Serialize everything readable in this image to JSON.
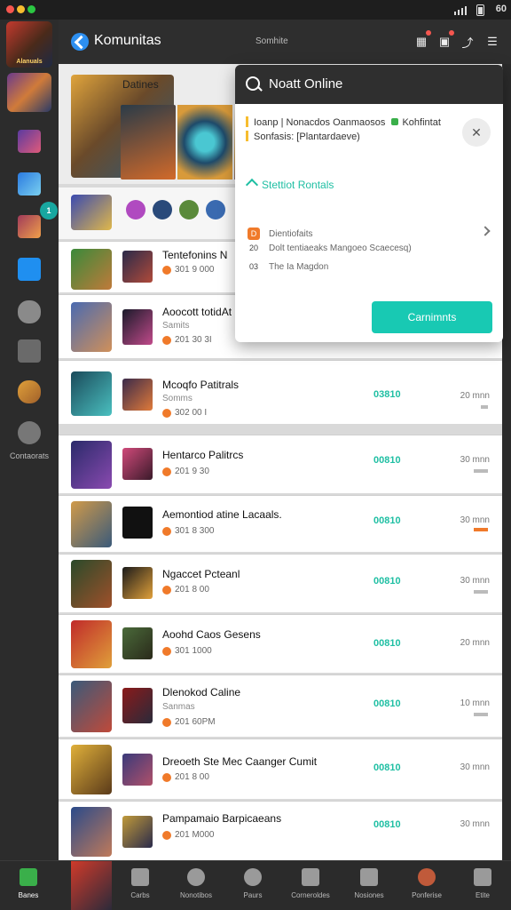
{
  "status_bar": {
    "right_text": "60"
  },
  "header": {
    "app_title": "Komunitas",
    "center_text": "Somhite"
  },
  "rail": {
    "badge": "1",
    "bottom_label": "Contaorats",
    "thumb_text": "Alanuals"
  },
  "featured": {
    "label": "Datines"
  },
  "rows": [
    {
      "title": "Tentefonins N",
      "meta": "301 9 000",
      "price": "",
      "time": ""
    },
    {
      "title": "Aoocott totidAt 1",
      "sub": "Samits",
      "meta": "201 30 3I",
      "price": "",
      "time": ""
    },
    {
      "title": "Mcoqfo Patitrals",
      "sub": "Somms",
      "meta": "302 00 I",
      "price": "03810",
      "time": "20 mnn"
    },
    {
      "title": "Hentarco Palitrcs",
      "meta": "201 9 30",
      "price": "00810",
      "time": "30 mnn"
    },
    {
      "title": "Aemontiod atine Lacaals.",
      "meta": "301 8 300",
      "price": "00810",
      "time": "30 mnn"
    },
    {
      "title": "Ngaccet Pcteanl",
      "meta": "201 8 00",
      "price": "00810",
      "time": "30 mnn"
    },
    {
      "title": "Aoohd Caos Gesens",
      "meta": "301 1000",
      "price": "00810",
      "time": "20 mnn"
    },
    {
      "title": "Dlenokod Caline",
      "sub": "Sanmas",
      "meta": "201 60PM",
      "price": "00810",
      "time": "10 mnn"
    },
    {
      "title": "Dreoeth Ste Mec Caanger Cumit",
      "meta": "201 8 00",
      "price": "00810",
      "time": "30 mnn"
    },
    {
      "title": "Pampamaio Barpicaeans",
      "meta": "201 M000",
      "price": "00810",
      "time": "30 mnn"
    }
  ],
  "popup": {
    "title": "Noatt Online",
    "line1": "Ioanp | Nonacdos Oanmaosos",
    "line1b": "Kohfintat",
    "line2": "Sonfasis: [Plantardaeve)",
    "link": "Stettiot Rontals",
    "opt1": "Dientiofaits",
    "opt1_num": "D",
    "opt2": "Dolt tentiaeaks Mangoeo Scaecesq)",
    "opt2_num": "20",
    "opt3": "The Ia Magdon",
    "opt3_num": "03",
    "button": "Carnimnts"
  },
  "bottom_nav": [
    {
      "label": "Banes",
      "icon": "home-icon"
    },
    {
      "label": "Carbs",
      "icon": "cards-icon"
    },
    {
      "label": "Nonotibos",
      "icon": "compass-icon"
    },
    {
      "label": "Paurs",
      "icon": "globe-icon"
    },
    {
      "label": "Corneroldes",
      "icon": "document-icon"
    },
    {
      "label": "Nosiones",
      "icon": "box-icon"
    },
    {
      "label": "Ponferise",
      "icon": "profile-icon"
    },
    {
      "label": "Etite",
      "icon": "mail-icon"
    }
  ],
  "colors": {
    "accent": "#18c9b3",
    "price": "#1fbfa3",
    "badge": "#f07a2a"
  }
}
